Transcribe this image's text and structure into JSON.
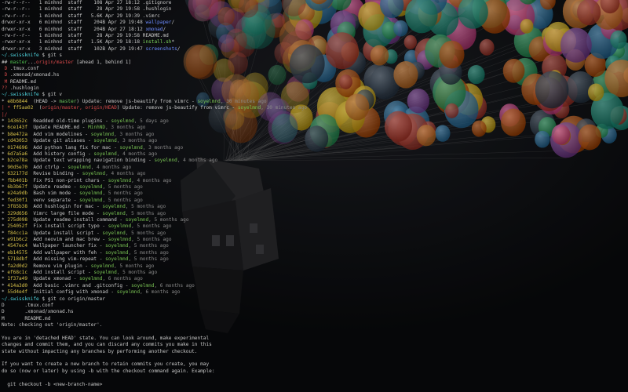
{
  "colors": {
    "default": "#c8c8c8",
    "dim": "#8a8a8a",
    "prompt_cyan": "#4fd6e0",
    "hash_yellow": "#d8c24a",
    "author_green": "#79c354",
    "ref_red": "#d94a4a",
    "ref_green": "#6cc65b",
    "dir_blue": "#6c8cff",
    "exec_green": "#7cd45c",
    "branch_green": "#4fc04f",
    "ahead_cyan": "#4fc8c8",
    "status_red": "#d04848",
    "balloon_palette": [
      "#c0392b",
      "#e67e22",
      "#f1c40f",
      "#27ae60",
      "#2980b9",
      "#8e44ad",
      "#e84393",
      "#16a085",
      "#d35400",
      "#2c3e50"
    ]
  },
  "wallpaper": {
    "subject": "house-lifted-by-balloons",
    "icons": [
      "balloon-cluster-icon",
      "house-icon"
    ]
  },
  "terminal": {
    "lines": [
      [
        {
          "t": "-rw-r--r--   1 minhnd  staff    108 Apr 27 18:12 ",
          "c": "default"
        },
        {
          "t": ".gitignore",
          "c": "default"
        }
      ],
      [
        {
          "t": "-rw-r--r--   1 minhnd  staff     28 Apr 29 19:58 ",
          "c": "default"
        },
        {
          "t": ".hushlogin",
          "c": "default"
        }
      ],
      [
        {
          "t": "-rw-r--r--   1 minhnd  staff   5.6K Apr 29 19:39 ",
          "c": "default"
        },
        {
          "t": ".vimrc",
          "c": "default"
        }
      ],
      [
        {
          "t": "drwxr-xr-x   6 minhnd  staff    204B Apr 29 19:48 ",
          "c": "default"
        },
        {
          "t": "wallpaper",
          "c": "dir_blue"
        },
        {
          "t": "/",
          "c": "default"
        }
      ],
      [
        {
          "t": "drwxr-xr-x   6 minhnd  staff    204B Apr 27 18:12 ",
          "c": "default"
        },
        {
          "t": "xmonad",
          "c": "dir_blue"
        },
        {
          "t": "/",
          "c": "default"
        }
      ],
      [
        {
          "t": "-rw-r--r--   1 minhnd  staff     28 Apr 29 19:58 ",
          "c": "default"
        },
        {
          "t": "README.md",
          "c": "default"
        }
      ],
      [
        {
          "t": "-rwxr-xr-x   1 minhnd  staff   1.5K Apr 29 18:18 ",
          "c": "default"
        },
        {
          "t": "install.sh",
          "c": "exec_green"
        },
        {
          "t": "*",
          "c": "default"
        }
      ],
      [
        {
          "t": "drwxr-xr-x   3 minhnd  staff    102B Apr 29 19:47 ",
          "c": "default"
        },
        {
          "t": "screenshots",
          "c": "dir_blue"
        },
        {
          "t": "/",
          "c": "default"
        }
      ],
      [
        {
          "t": "~/.swissknife",
          "c": "prompt_cyan"
        },
        {
          "t": " $ git s",
          "c": "default"
        }
      ],
      [
        {
          "t": "## ",
          "c": "default"
        },
        {
          "t": "master",
          "c": "branch_green"
        },
        {
          "t": "...",
          "c": "default"
        },
        {
          "t": "origin/master",
          "c": "ref_red"
        },
        {
          "t": " [ahead 1, behind 1]",
          "c": "default"
        }
      ],
      [
        {
          "t": " D ",
          "c": "status_red"
        },
        {
          "t": ".tmux.conf",
          "c": "default"
        }
      ],
      [
        {
          "t": " D ",
          "c": "status_red"
        },
        {
          "t": ".xmonad/xmonad.hs",
          "c": "default"
        }
      ],
      [
        {
          "t": " M ",
          "c": "status_red"
        },
        {
          "t": "README.md",
          "c": "default"
        }
      ],
      [
        {
          "t": "?? ",
          "c": "status_red"
        },
        {
          "t": ".hushlogin",
          "c": "default"
        }
      ],
      [
        {
          "t": "~/.swissknife",
          "c": "prompt_cyan"
        },
        {
          "t": " $ git v",
          "c": "default"
        }
      ],
      [
        {
          "t": "* ",
          "c": "default"
        },
        {
          "t": "e8b6844",
          "c": "hash_yellow"
        },
        {
          "t": "  (HEAD -> ",
          "c": "default"
        },
        {
          "t": "master",
          "c": "ref_green"
        },
        {
          "t": ") Update: remove js-beautify from vimrc - ",
          "c": "default"
        },
        {
          "t": "soyelmnd",
          "c": "author_green"
        },
        {
          "t": ", 30 minutes ago",
          "c": "dim"
        }
      ],
      [
        {
          "t": "| * ",
          "c": "ref_red"
        },
        {
          "t": "ff5aa02",
          "c": "hash_yellow"
        },
        {
          "t": "  (",
          "c": "default"
        },
        {
          "t": "origin/master, origin/HEAD",
          "c": "ref_red"
        },
        {
          "t": ") Update: remove js-beautify from vimrc - ",
          "c": "default"
        },
        {
          "t": "soyelmnd",
          "c": "author_green"
        },
        {
          "t": ", 30 minutes ago",
          "c": "dim"
        }
      ],
      [
        {
          "t": "|/",
          "c": "ref_red"
        }
      ],
      [
        {
          "t": "* ",
          "c": "default"
        },
        {
          "t": "143652c",
          "c": "hash_yellow"
        },
        {
          "t": "  Readded old-time plugins - ",
          "c": "default"
        },
        {
          "t": "soyelmnd",
          "c": "author_green"
        },
        {
          "t": ", 5 days ago",
          "c": "dim"
        }
      ],
      [
        {
          "t": "* ",
          "c": "default"
        },
        {
          "t": "6ce143f",
          "c": "hash_yellow"
        },
        {
          "t": "  Update README.md - ",
          "c": "default"
        },
        {
          "t": "MinhND",
          "c": "author_green"
        },
        {
          "t": ", 3 months ago",
          "c": "dim"
        }
      ],
      [
        {
          "t": "* ",
          "c": "default"
        },
        {
          "t": "b8e472a",
          "c": "hash_yellow"
        },
        {
          "t": "  Add vim modelines - ",
          "c": "default"
        },
        {
          "t": "soyelmnd",
          "c": "author_green"
        },
        {
          "t": ", 3 months ago",
          "c": "dim"
        }
      ],
      [
        {
          "t": "* ",
          "c": "default"
        },
        {
          "t": "cd43053",
          "c": "hash_yellow"
        },
        {
          "t": "  Update git aliases - ",
          "c": "default"
        },
        {
          "t": "soyelmnd",
          "c": "author_green"
        },
        {
          "t": ", 3 months ago",
          "c": "dim"
        }
      ],
      [
        {
          "t": "* ",
          "c": "default"
        },
        {
          "t": "0174696",
          "c": "hash_yellow"
        },
        {
          "t": "  Add python lang fix for mac - ",
          "c": "default"
        },
        {
          "t": "soyelmnd",
          "c": "author_green"
        },
        {
          "t": ", 3 months ago",
          "c": "dim"
        }
      ],
      [
        {
          "t": "* ",
          "c": "default"
        },
        {
          "t": "6d7a5a6",
          "c": "hash_yellow"
        },
        {
          "t": "  Add history config - ",
          "c": "default"
        },
        {
          "t": "soyelmnd",
          "c": "author_green"
        },
        {
          "t": ", 4 months ago",
          "c": "dim"
        }
      ],
      [
        {
          "t": "* ",
          "c": "default"
        },
        {
          "t": "b2ce78a",
          "c": "hash_yellow"
        },
        {
          "t": "  Update text wrapping navigation binding - ",
          "c": "default"
        },
        {
          "t": "soyelmnd",
          "c": "author_green"
        },
        {
          "t": ", 4 months ago",
          "c": "dim"
        }
      ],
      [
        {
          "t": "* ",
          "c": "default"
        },
        {
          "t": "90d5e70",
          "c": "hash_yellow"
        },
        {
          "t": "  Add ctrlp - ",
          "c": "default"
        },
        {
          "t": "soyelmnd",
          "c": "author_green"
        },
        {
          "t": ", 4 months ago",
          "c": "dim"
        }
      ],
      [
        {
          "t": "* ",
          "c": "default"
        },
        {
          "t": "632177d",
          "c": "hash_yellow"
        },
        {
          "t": "  Revise binding - ",
          "c": "default"
        },
        {
          "t": "soyelmnd",
          "c": "author_green"
        },
        {
          "t": ", 4 months ago",
          "c": "dim"
        }
      ],
      [
        {
          "t": "* ",
          "c": "default"
        },
        {
          "t": "fbb401b",
          "c": "hash_yellow"
        },
        {
          "t": "  Fix PS1 non-print chars - ",
          "c": "default"
        },
        {
          "t": "soyelmnd",
          "c": "author_green"
        },
        {
          "t": ", 4 months ago",
          "c": "dim"
        }
      ],
      [
        {
          "t": "* ",
          "c": "default"
        },
        {
          "t": "6b3b67f",
          "c": "hash_yellow"
        },
        {
          "t": "  Update readme - ",
          "c": "default"
        },
        {
          "t": "soyelmnd",
          "c": "author_green"
        },
        {
          "t": ", 5 months ago",
          "c": "dim"
        }
      ],
      [
        {
          "t": "* ",
          "c": "default"
        },
        {
          "t": "e24a9db",
          "c": "hash_yellow"
        },
        {
          "t": "  Bash vim mode - ",
          "c": "default"
        },
        {
          "t": "soyelmnd",
          "c": "author_green"
        },
        {
          "t": ", 5 months ago",
          "c": "dim"
        }
      ],
      [
        {
          "t": "* ",
          "c": "default"
        },
        {
          "t": "fed30f1",
          "c": "hash_yellow"
        },
        {
          "t": "  venv separate - ",
          "c": "default"
        },
        {
          "t": "soyelmnd",
          "c": "author_green"
        },
        {
          "t": ", 5 months ago",
          "c": "dim"
        }
      ],
      [
        {
          "t": "* ",
          "c": "default"
        },
        {
          "t": "3f85b38",
          "c": "hash_yellow"
        },
        {
          "t": "  Add hushlogin for mac - ",
          "c": "default"
        },
        {
          "t": "soyelmnd",
          "c": "author_green"
        },
        {
          "t": ", 5 months ago",
          "c": "dim"
        }
      ],
      [
        {
          "t": "* ",
          "c": "default"
        },
        {
          "t": "329d656",
          "c": "hash_yellow"
        },
        {
          "t": "  Vimrc large file mode - ",
          "c": "default"
        },
        {
          "t": "soyelmnd",
          "c": "author_green"
        },
        {
          "t": ", 5 months ago",
          "c": "dim"
        }
      ],
      [
        {
          "t": "* ",
          "c": "default"
        },
        {
          "t": "275d098",
          "c": "hash_yellow"
        },
        {
          "t": "  Update readme install command - ",
          "c": "default"
        },
        {
          "t": "soyelmnd",
          "c": "author_green"
        },
        {
          "t": ", 5 months ago",
          "c": "dim"
        }
      ],
      [
        {
          "t": "* ",
          "c": "default"
        },
        {
          "t": "254052f",
          "c": "hash_yellow"
        },
        {
          "t": "  Fix install script typo - ",
          "c": "default"
        },
        {
          "t": "soyelmnd",
          "c": "author_green"
        },
        {
          "t": ", 5 months ago",
          "c": "dim"
        }
      ],
      [
        {
          "t": "* ",
          "c": "default"
        },
        {
          "t": "f84cc1a",
          "c": "hash_yellow"
        },
        {
          "t": "  Update install script - ",
          "c": "default"
        },
        {
          "t": "soyelmnd",
          "c": "author_green"
        },
        {
          "t": ", 5 months ago",
          "c": "dim"
        }
      ],
      [
        {
          "t": "* ",
          "c": "default"
        },
        {
          "t": "e91b6c2",
          "c": "hash_yellow"
        },
        {
          "t": "  Add neovim and mac brew - ",
          "c": "default"
        },
        {
          "t": "soyelmnd",
          "c": "author_green"
        },
        {
          "t": ", 5 months ago",
          "c": "dim"
        }
      ],
      [
        {
          "t": "* ",
          "c": "default"
        },
        {
          "t": "4547ec4",
          "c": "hash_yellow"
        },
        {
          "t": "  Wallpaper launcher fix - ",
          "c": "default"
        },
        {
          "t": "soyelmnd",
          "c": "author_green"
        },
        {
          "t": ", 5 months ago",
          "c": "dim"
        }
      ],
      [
        {
          "t": "* ",
          "c": "default"
        },
        {
          "t": "eb14575",
          "c": "hash_yellow"
        },
        {
          "t": "  Add wallpaper with feh - ",
          "c": "default"
        },
        {
          "t": "soyelmnd",
          "c": "author_green"
        },
        {
          "t": ", 5 months ago",
          "c": "dim"
        }
      ],
      [
        {
          "t": "* ",
          "c": "default"
        },
        {
          "t": "5718dbf",
          "c": "hash_yellow"
        },
        {
          "t": "  Add missing vim-repeat - ",
          "c": "default"
        },
        {
          "t": "soyelmnd",
          "c": "author_green"
        },
        {
          "t": ", 5 months ago",
          "c": "dim"
        }
      ],
      [
        {
          "t": "* ",
          "c": "default"
        },
        {
          "t": "fa2d0d2",
          "c": "hash_yellow"
        },
        {
          "t": "  Remove vim plugin - ",
          "c": "default"
        },
        {
          "t": "soyelmnd",
          "c": "author_green"
        },
        {
          "t": ", 5 months ago",
          "c": "dim"
        }
      ],
      [
        {
          "t": "* ",
          "c": "default"
        },
        {
          "t": "ef68c1c",
          "c": "hash_yellow"
        },
        {
          "t": "  Add install script - ",
          "c": "default"
        },
        {
          "t": "soyelmnd",
          "c": "author_green"
        },
        {
          "t": ", 5 months ago",
          "c": "dim"
        }
      ],
      [
        {
          "t": "* ",
          "c": "default"
        },
        {
          "t": "1f37a49",
          "c": "hash_yellow"
        },
        {
          "t": "  Update xmonad - ",
          "c": "default"
        },
        {
          "t": "soyelmnd",
          "c": "author_green"
        },
        {
          "t": ", 6 months ago",
          "c": "dim"
        }
      ],
      [
        {
          "t": "* ",
          "c": "default"
        },
        {
          "t": "414a3d0",
          "c": "hash_yellow"
        },
        {
          "t": "  Add basic .vimrc and .gitconfig - ",
          "c": "default"
        },
        {
          "t": "soyelmnd",
          "c": "author_green"
        },
        {
          "t": ", 6 months ago",
          "c": "dim"
        }
      ],
      [
        {
          "t": "* ",
          "c": "default"
        },
        {
          "t": "55d4e4f",
          "c": "hash_yellow"
        },
        {
          "t": "  Initial config with xmonad - ",
          "c": "default"
        },
        {
          "t": "soyelmnd",
          "c": "author_green"
        },
        {
          "t": ", 6 months ago",
          "c": "dim"
        }
      ],
      [
        {
          "t": "~/.swissknife",
          "c": "prompt_cyan"
        },
        {
          "t": " $ git co origin/master",
          "c": "default"
        }
      ],
      [
        {
          "t": "D       .tmux.conf",
          "c": "default"
        }
      ],
      [
        {
          "t": "D       .xmonad/xmonad.hs",
          "c": "default"
        }
      ],
      [
        {
          "t": "M       README.md",
          "c": "default"
        }
      ],
      [
        {
          "t": "Note: checking out 'origin/master'.",
          "c": "default"
        }
      ],
      [
        {
          "t": "",
          "c": "default"
        }
      ],
      [
        {
          "t": "You are in 'detached HEAD' state. You can look around, make experimental",
          "c": "default"
        }
      ],
      [
        {
          "t": "changes and commit them, and you can discard any commits you make in this",
          "c": "default"
        }
      ],
      [
        {
          "t": "state without impacting any branches by performing another checkout.",
          "c": "default"
        }
      ],
      [
        {
          "t": "",
          "c": "default"
        }
      ],
      [
        {
          "t": "If you want to create a new branch to retain commits you create, you may",
          "c": "default"
        }
      ],
      [
        {
          "t": "do so (now or later) by using -b with the checkout command again. Example:",
          "c": "default"
        }
      ],
      [
        {
          "t": "",
          "c": "default"
        }
      ],
      [
        {
          "t": "  git checkout -b <new-branch-name>",
          "c": "default"
        }
      ],
      [
        {
          "t": "",
          "c": "default"
        }
      ],
      [
        {
          "t": "HEAD is now at ff5aa02... Update: remove js-beautify from vimrc",
          "c": "default"
        }
      ],
      [
        {
          "t": "~/.swissknife",
          "c": "prompt_cyan"
        },
        {
          "t": " $ ",
          "c": "default"
        }
      ]
    ]
  }
}
